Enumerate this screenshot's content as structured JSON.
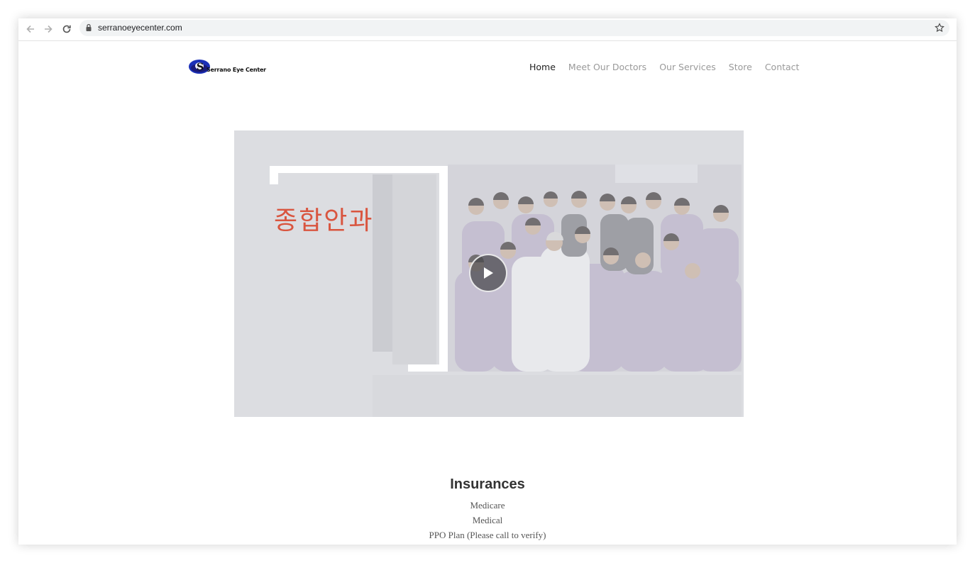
{
  "browser": {
    "url": "serranoeyecenter.com"
  },
  "site": {
    "logo_text": "Serrano Eye Center",
    "nav": [
      {
        "label": "Home"
      },
      {
        "label": "Meet Our Doctors"
      },
      {
        "label": "Our Services"
      },
      {
        "label": "Store"
      },
      {
        "label": "Contact"
      }
    ]
  },
  "video": {
    "overlay_text": "종합안과"
  },
  "insurances": {
    "title": "Insurances",
    "items": [
      "Medicare",
      "Medical",
      "PPO Plan (Please call to verify)"
    ]
  },
  "colors": {
    "accent_red": "#d9553f",
    "video_bg": "#dcdde1",
    "nav_active": "#222222",
    "nav_inactive": "#9a9a9a"
  }
}
